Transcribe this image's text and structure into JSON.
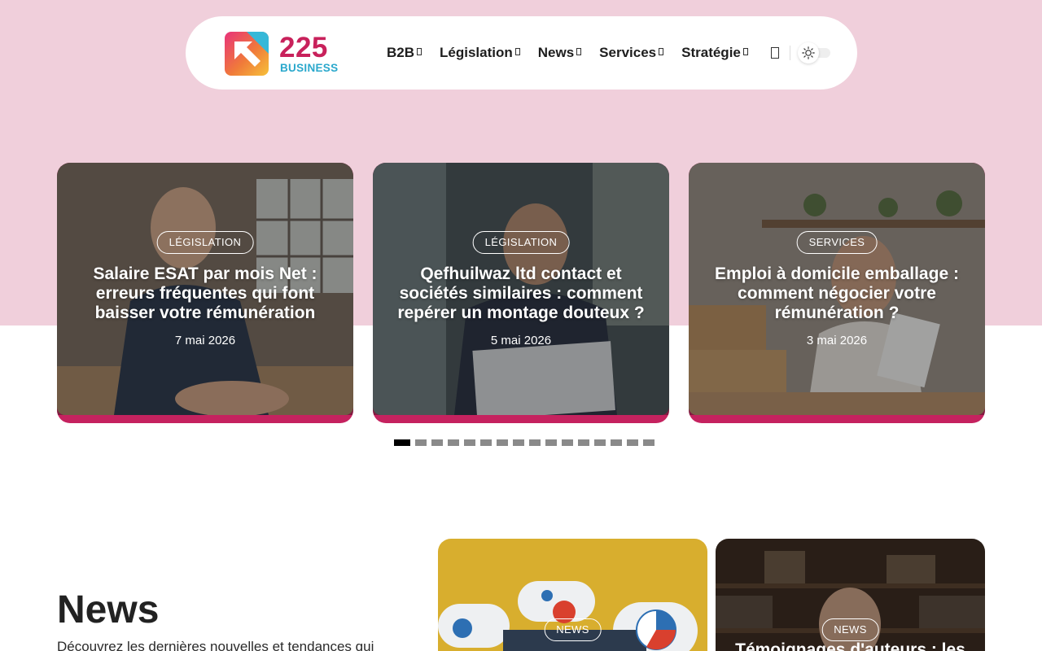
{
  "header": {
    "logo_number": "225",
    "logo_word": "BUSINESS",
    "menu": [
      {
        "label": "B2B"
      },
      {
        "label": "Législation"
      },
      {
        "label": "News"
      },
      {
        "label": "Services"
      },
      {
        "label": "Stratégie"
      }
    ]
  },
  "slider": {
    "cards": [
      {
        "category": "LÉGISLATION",
        "title": "Salaire ESAT par mois Net : erreurs fréquentes qui font baisser votre rémunération",
        "date": "7 mai 2026"
      },
      {
        "category": "LÉGISLATION",
        "title": "Qefhuilwaz ltd contact et sociétés similaires : comment repérer un montage douteux ?",
        "date": "5 mai 2026"
      },
      {
        "category": "SERVICES",
        "title": "Emploi à domicile emballage : comment négocier votre rémunération ?",
        "date": "3 mai 2026"
      }
    ],
    "pagination": {
      "total": 16,
      "active": 1
    }
  },
  "news_section": {
    "heading": "News",
    "description": "Découvrez les dernières nouvelles et tendances qui",
    "cards": [
      {
        "category": "NEWS",
        "title": ""
      },
      {
        "category": "NEWS",
        "title": "Témoignages d'auteurs : les"
      }
    ]
  },
  "colors": {
    "band": "#f0cfdb",
    "accent": "#c5225f",
    "logo_teal": "#2aa8cc"
  }
}
